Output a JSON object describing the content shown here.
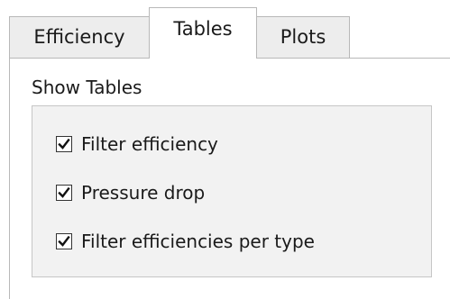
{
  "tabs": [
    {
      "label": "Efficiency",
      "selected": false
    },
    {
      "label": "Tables",
      "selected": true
    },
    {
      "label": "Plots",
      "selected": false
    }
  ],
  "panel": {
    "section_label": "Show Tables",
    "options": [
      {
        "label": "Filter efficiency",
        "checked": true
      },
      {
        "label": "Pressure drop",
        "checked": true
      },
      {
        "label": "Filter efficiencies per type",
        "checked": true
      }
    ]
  },
  "colors": {
    "tab_inactive_bg": "#ededed",
    "tab_active_bg": "#ffffff",
    "border": "#b8b8b8",
    "group_bg": "#f2f2f2",
    "text": "#1a1a1a"
  }
}
